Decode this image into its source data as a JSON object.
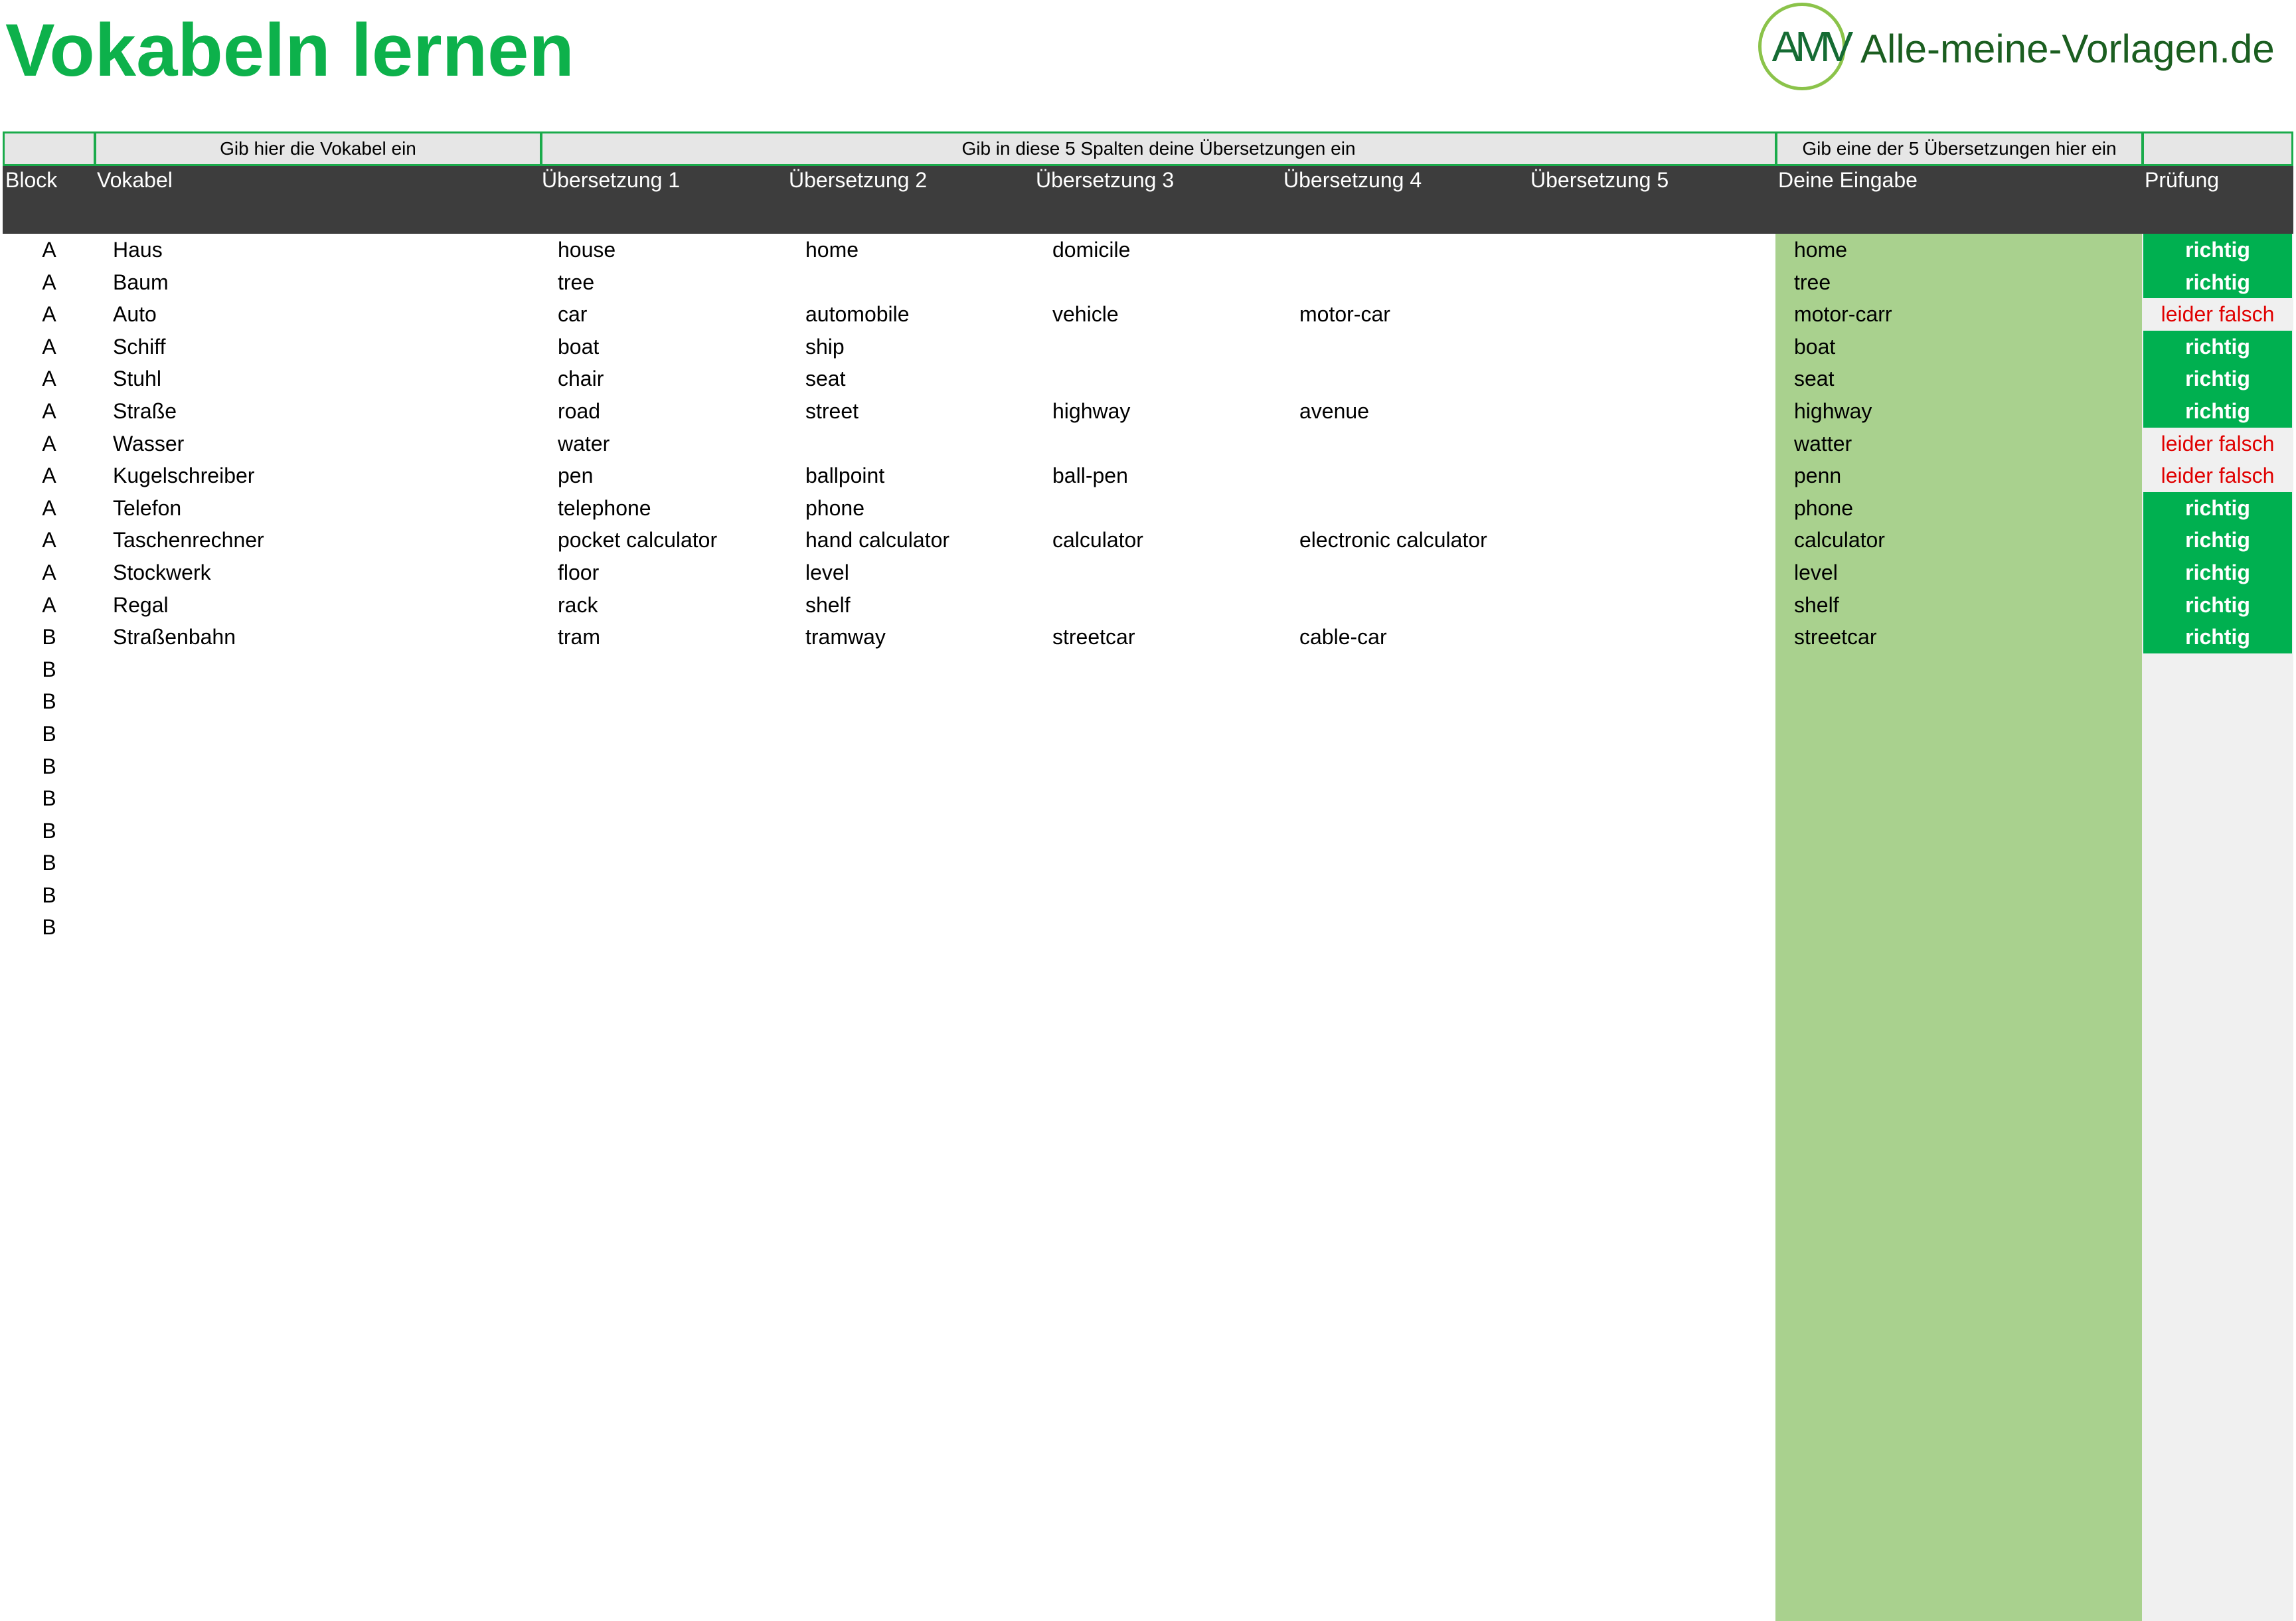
{
  "page": {
    "title": "Vokabeln lernen",
    "logo": {
      "mark": "AMV",
      "text": "Alle-meine-Vorlagen.de"
    }
  },
  "colors": {
    "title": "#0db14b",
    "logo_text": "#1b5e20",
    "logo_mark": "#156b33",
    "logo_ring": "#8bc34a",
    "hint_border": "#1aab4b",
    "header_bg": "#3d3d3d",
    "input_band": "#a9d18e",
    "check_band": "#f0f0f0",
    "check_ok_bg": "#00b050",
    "check_bad_text": "#e00000"
  },
  "hints": {
    "vocab": "Gib hier die Vokabel ein",
    "translations": "Gib in diese 5 Spalten deine Übersetzungen ein",
    "input": "Gib eine der 5 Übersetzungen hier ein"
  },
  "columns": {
    "block": "Block",
    "vokabel": "Vokabel",
    "t1": "Übersetzung 1",
    "t2": "Übersetzung 2",
    "t3": "Übersetzung 3",
    "t4": "Übersetzung 4",
    "t5": "Übersetzung 5",
    "eingabe": "Deine Eingabe",
    "pruefung": "Prüfung"
  },
  "rows": [
    {
      "block": "A",
      "vokabel": "Haus",
      "t1": "house",
      "t2": "home",
      "t3": "domicile",
      "t4": "",
      "t5": "",
      "eingabe": "home",
      "pruefung": "richtig"
    },
    {
      "block": "A",
      "vokabel": "Baum",
      "t1": "tree",
      "t2": "",
      "t3": "",
      "t4": "",
      "t5": "",
      "eingabe": "tree",
      "pruefung": "richtig"
    },
    {
      "block": "A",
      "vokabel": "Auto",
      "t1": "car",
      "t2": "automobile",
      "t3": "vehicle",
      "t4": "motor-car",
      "t5": "",
      "eingabe": "motor-carr",
      "pruefung": "leider falsch"
    },
    {
      "block": "A",
      "vokabel": "Schiff",
      "t1": "boat",
      "t2": "ship",
      "t3": "",
      "t4": "",
      "t5": "",
      "eingabe": "boat",
      "pruefung": "richtig"
    },
    {
      "block": "A",
      "vokabel": "Stuhl",
      "t1": "chair",
      "t2": "seat",
      "t3": "",
      "t4": "",
      "t5": "",
      "eingabe": "seat",
      "pruefung": "richtig"
    },
    {
      "block": "A",
      "vokabel": "Straße",
      "t1": "road",
      "t2": "street",
      "t3": "highway",
      "t4": "avenue",
      "t5": "",
      "eingabe": "highway",
      "pruefung": "richtig"
    },
    {
      "block": "A",
      "vokabel": "Wasser",
      "t1": "water",
      "t2": "",
      "t3": "",
      "t4": "",
      "t5": "",
      "eingabe": "watter",
      "pruefung": "leider falsch"
    },
    {
      "block": "A",
      "vokabel": "Kugelschreiber",
      "t1": "pen",
      "t2": "ballpoint",
      "t3": "ball-pen",
      "t4": "",
      "t5": "",
      "eingabe": "penn",
      "pruefung": "leider falsch"
    },
    {
      "block": "A",
      "vokabel": "Telefon",
      "t1": "telephone",
      "t2": "phone",
      "t3": "",
      "t4": "",
      "t5": "",
      "eingabe": "phone",
      "pruefung": "richtig"
    },
    {
      "block": "A",
      "vokabel": "Taschenrechner",
      "t1": "pocket calculator",
      "t2": "hand calculator",
      "t3": "calculator",
      "t4": "electronic calculator",
      "t5": "",
      "eingabe": "calculator",
      "pruefung": "richtig"
    },
    {
      "block": "A",
      "vokabel": "Stockwerk",
      "t1": "floor",
      "t2": "level",
      "t3": "",
      "t4": "",
      "t5": "",
      "eingabe": "level",
      "pruefung": "richtig"
    },
    {
      "block": "A",
      "vokabel": "Regal",
      "t1": "rack",
      "t2": "shelf",
      "t3": "",
      "t4": "",
      "t5": "",
      "eingabe": "shelf",
      "pruefung": "richtig"
    },
    {
      "block": "B",
      "vokabel": "Straßenbahn",
      "t1": "tram",
      "t2": "tramway",
      "t3": "streetcar",
      "t4": "cable-car",
      "t5": "",
      "eingabe": "streetcar",
      "pruefung": "richtig"
    },
    {
      "block": "B",
      "vokabel": "",
      "t1": "",
      "t2": "",
      "t3": "",
      "t4": "",
      "t5": "",
      "eingabe": "",
      "pruefung": ""
    },
    {
      "block": "B",
      "vokabel": "",
      "t1": "",
      "t2": "",
      "t3": "",
      "t4": "",
      "t5": "",
      "eingabe": "",
      "pruefung": ""
    },
    {
      "block": "B",
      "vokabel": "",
      "t1": "",
      "t2": "",
      "t3": "",
      "t4": "",
      "t5": "",
      "eingabe": "",
      "pruefung": ""
    },
    {
      "block": "B",
      "vokabel": "",
      "t1": "",
      "t2": "",
      "t3": "",
      "t4": "",
      "t5": "",
      "eingabe": "",
      "pruefung": ""
    },
    {
      "block": "B",
      "vokabel": "",
      "t1": "",
      "t2": "",
      "t3": "",
      "t4": "",
      "t5": "",
      "eingabe": "",
      "pruefung": ""
    },
    {
      "block": "B",
      "vokabel": "",
      "t1": "",
      "t2": "",
      "t3": "",
      "t4": "",
      "t5": "",
      "eingabe": "",
      "pruefung": ""
    },
    {
      "block": "B",
      "vokabel": "",
      "t1": "",
      "t2": "",
      "t3": "",
      "t4": "",
      "t5": "",
      "eingabe": "",
      "pruefung": ""
    },
    {
      "block": "B",
      "vokabel": "",
      "t1": "",
      "t2": "",
      "t3": "",
      "t4": "",
      "t5": "",
      "eingabe": "",
      "pruefung": ""
    },
    {
      "block": "B",
      "vokabel": "",
      "t1": "",
      "t2": "",
      "t3": "",
      "t4": "",
      "t5": "",
      "eingabe": "",
      "pruefung": ""
    }
  ]
}
